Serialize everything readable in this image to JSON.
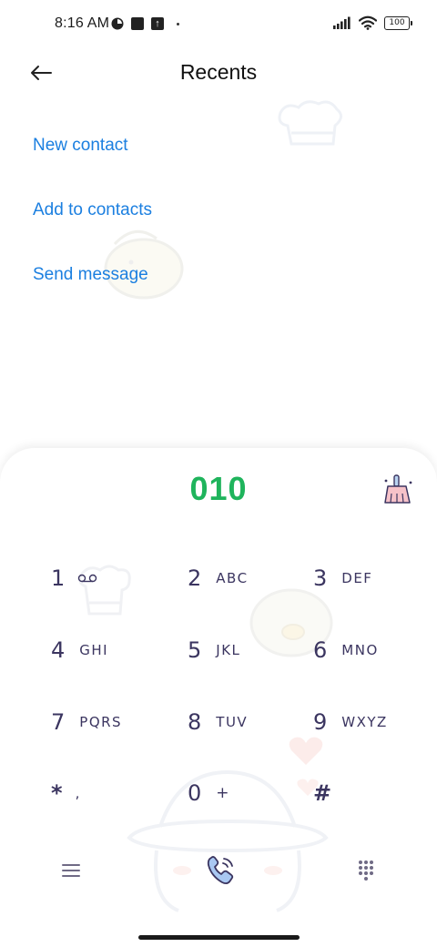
{
  "status_bar": {
    "time": "8:16 AM",
    "battery": "100"
  },
  "header": {
    "title": "Recents"
  },
  "actions": [
    {
      "label": "New contact"
    },
    {
      "label": "Add to contacts"
    },
    {
      "label": "Send message"
    }
  ],
  "dialer": {
    "number": "010",
    "keys": [
      {
        "digit": "1",
        "letters": ""
      },
      {
        "digit": "2",
        "letters": "ABC"
      },
      {
        "digit": "3",
        "letters": "DEF"
      },
      {
        "digit": "4",
        "letters": "GHI"
      },
      {
        "digit": "5",
        "letters": "JKL"
      },
      {
        "digit": "6",
        "letters": "MNO"
      },
      {
        "digit": "7",
        "letters": "PQRS"
      },
      {
        "digit": "8",
        "letters": "TUV"
      },
      {
        "digit": "9",
        "letters": "WXYZ"
      },
      {
        "digit": "*",
        "letters": ","
      },
      {
        "digit": "0",
        "letters": "+"
      },
      {
        "digit": "#",
        "letters": ""
      }
    ]
  },
  "colors": {
    "accent_link": "#1b7fe0",
    "number_green": "#1fb45c",
    "key_text": "#3b3560",
    "call_blue": "#5c8fe0"
  },
  "icons": {
    "back": "arrow-left-icon",
    "clear": "broom-icon",
    "menu": "hamburger-icon",
    "call": "phone-icon",
    "keypad": "keypad-grid-icon",
    "voicemail": "voicemail-icon"
  }
}
